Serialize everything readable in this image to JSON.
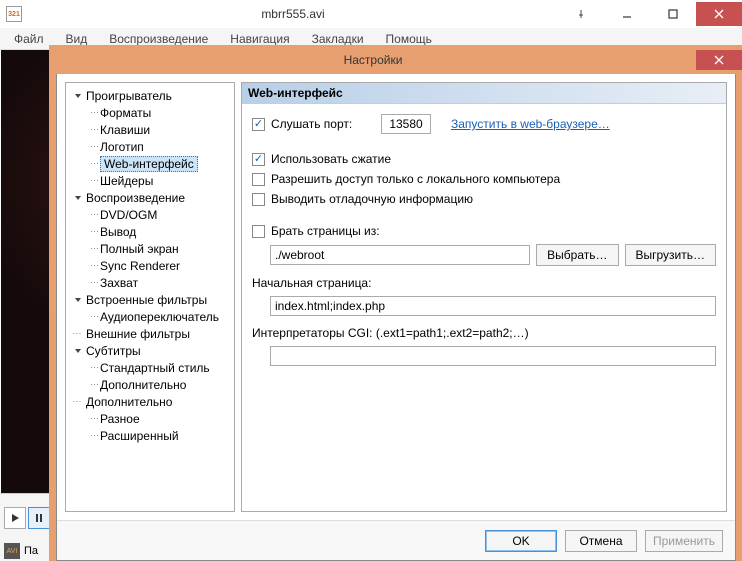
{
  "app": {
    "title": "mbrr555.avi",
    "icon_text": "321"
  },
  "menubar": {
    "file": "Файл",
    "view": "Вид",
    "play": "Воспроизведение",
    "nav": "Навигация",
    "bookmarks": "Закладки",
    "help": "Помощь"
  },
  "status": {
    "label_prefix": "Па"
  },
  "settings": {
    "title": "Настройки",
    "tree": {
      "player": "Проигрыватель",
      "formats": "Форматы",
      "keys": "Клавиши",
      "logo": "Логотип",
      "web": "Web-интерфейс",
      "shaders": "Шейдеры",
      "playback": "Воспроизведение",
      "dvd": "DVD/OGM",
      "output": "Вывод",
      "fullscreen": "Полный экран",
      "sync": "Sync Renderer",
      "capture": "Захват",
      "internal": "Встроенные фильтры",
      "audiosw": "Аудиопереключатель",
      "external": "Внешние фильтры",
      "subtitles": "Субтитры",
      "style": "Стандартный стиль",
      "misc_sub": "Дополнительно",
      "misc": "Дополнительно",
      "various": "Разное",
      "advanced": "Расширенный"
    },
    "panel": {
      "header": "Web-интерфейс",
      "listen_port": "Слушать порт:",
      "port_value": "13580",
      "open_browser": "Запустить в web-браузере…",
      "use_compression": "Использовать сжатие",
      "local_only": "Разрешить доступ только с локального компьютера",
      "debug_info": "Выводить отладочную информацию",
      "serve_pages": "Брать страницы из:",
      "root_path": "./webroot",
      "browse": "Выбрать…",
      "deploy": "Выгрузить…",
      "default_page": "Начальная страница:",
      "default_page_value": "index.html;index.php",
      "cgi_label": "Интерпретаторы CGI: (.ext1=path1;.ext2=path2;…)",
      "cgi_value": ""
    },
    "buttons": {
      "ok": "OK",
      "cancel": "Отмена",
      "apply": "Применить"
    }
  }
}
